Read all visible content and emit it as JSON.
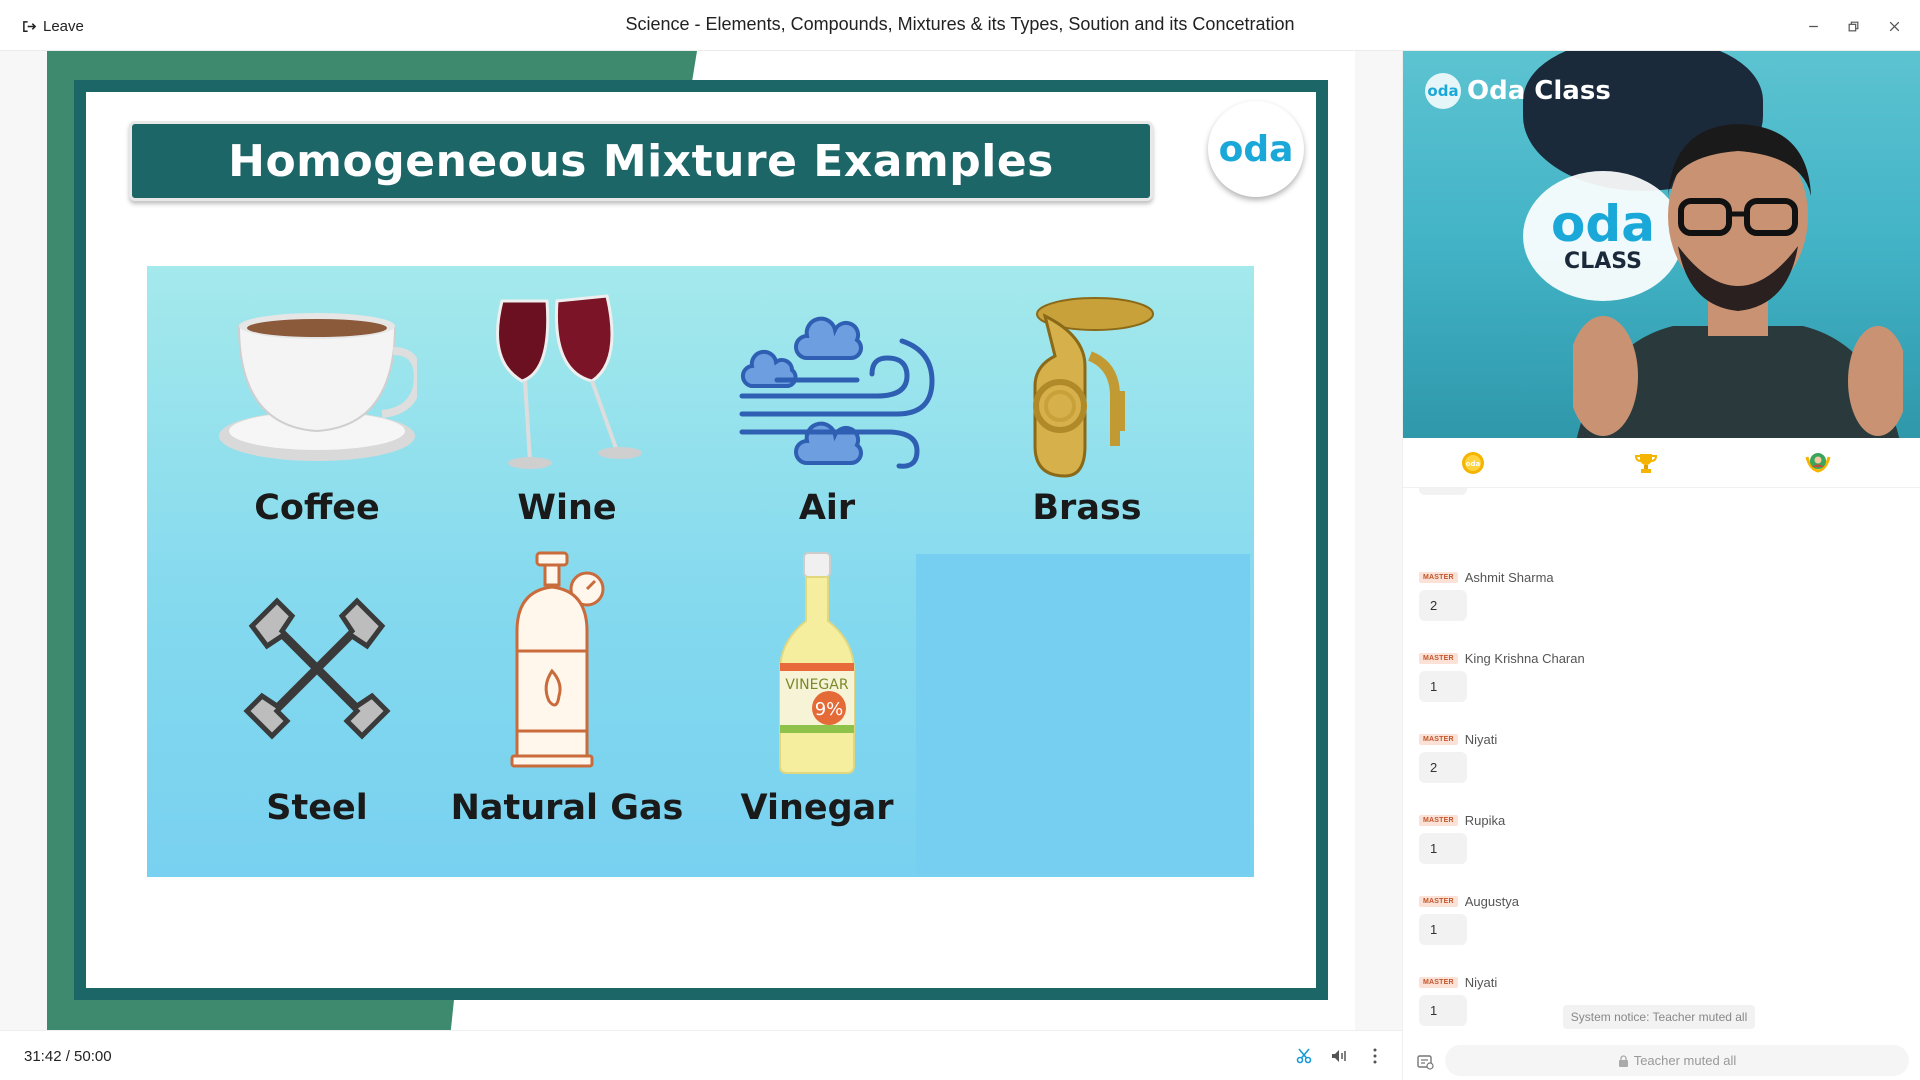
{
  "titlebar": {
    "leave_label": "Leave",
    "title": "Science - Elements, Compounds, Mixtures & its Types, Soution and its Concetration"
  },
  "slide": {
    "title": "Homogeneous Mixture Examples",
    "logo_text": "oda",
    "items": [
      {
        "label": "Coffee",
        "icon": "coffee-cup-icon"
      },
      {
        "label": "Wine",
        "icon": "wine-glasses-icon"
      },
      {
        "label": "Air",
        "icon": "wind-clouds-icon"
      },
      {
        "label": "Brass",
        "icon": "tuba-icon"
      },
      {
        "label": "Steel",
        "icon": "crossed-wrenches-icon"
      },
      {
        "label": "Natural Gas",
        "icon": "gas-cylinder-icon"
      },
      {
        "label": "Vinegar",
        "icon": "vinegar-bottle-icon"
      }
    ],
    "vinegar_label": "VINEGAR",
    "vinegar_percent": "9%",
    "colors": {
      "teal": "#1c6668",
      "green_band": "#3d8a6e",
      "panel": "#82d8ee",
      "oda_blue": "#1aa8d9"
    }
  },
  "bottombar": {
    "time": "31:42 / 50:00"
  },
  "video": {
    "brand_circle": "oda",
    "brand_text": "Oda Class",
    "bg_logo_top": "oda",
    "bg_logo_bottom": "CLASS"
  },
  "tabs": [
    {
      "icon": "oda-coin-icon"
    },
    {
      "icon": "trophy-icon"
    },
    {
      "icon": "award-badge-icon"
    }
  ],
  "answers": [
    {
      "badge": "MASTER",
      "name": "Ashmit Sharma",
      "answer": "2"
    },
    {
      "badge": "MASTER",
      "name": "King Krishna Charan",
      "answer": "1"
    },
    {
      "badge": "MASTER",
      "name": "Niyati",
      "answer": "2"
    },
    {
      "badge": "MASTER",
      "name": "Rupika",
      "answer": "1"
    },
    {
      "badge": "MASTER",
      "name": "Augustya",
      "answer": "1"
    },
    {
      "badge": "MASTER",
      "name": "Niyati",
      "answer": "1"
    }
  ],
  "system_notice": "System notice: Teacher muted all",
  "chat": {
    "input_placeholder": "Teacher muted all"
  }
}
